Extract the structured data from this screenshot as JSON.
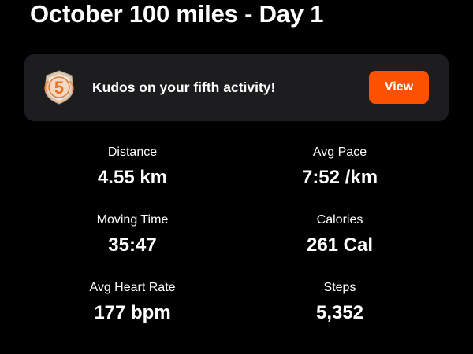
{
  "activity": {
    "title": "October 100 miles - Day 1"
  },
  "kudos": {
    "badge_number": "5",
    "message": "Kudos on your fifth activity!",
    "view_label": "View"
  },
  "stats": [
    {
      "label": "Distance",
      "value": "4.55 km"
    },
    {
      "label": "Avg Pace",
      "value": "7:52 /km"
    },
    {
      "label": "Moving Time",
      "value": "35:47"
    },
    {
      "label": "Calories",
      "value": "261 Cal"
    },
    {
      "label": "Avg Heart Rate",
      "value": "177 bpm"
    },
    {
      "label": "Steps",
      "value": "5,352"
    }
  ],
  "colors": {
    "accent": "#fc5200",
    "card_background": "#1d1d1f",
    "page_background": "#000000"
  },
  "icons": {
    "badge": "milestone-badge-icon"
  }
}
